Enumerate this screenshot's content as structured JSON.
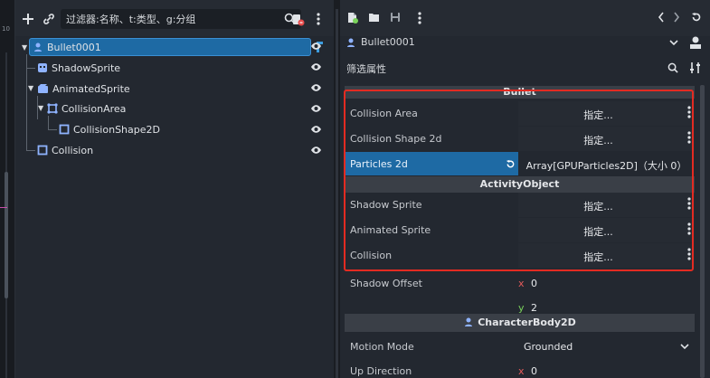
{
  "left_strip": {
    "number": "10"
  },
  "scene_dock": {
    "filter_placeholder": "过滤器:名称、t:类型、g:分组",
    "tree": [
      {
        "label": "Bullet0001",
        "icon": "character-body-icon",
        "selected": true
      },
      {
        "label": "ShadowSprite",
        "icon": "sprite-icon"
      },
      {
        "label": "AnimatedSprite",
        "icon": "animated-sprite-icon"
      },
      {
        "label": "CollisionArea",
        "icon": "area-icon"
      },
      {
        "label": "CollisionShape2D",
        "icon": "collision-shape-icon"
      },
      {
        "label": "Collision",
        "icon": "collision-shape-icon"
      }
    ]
  },
  "inspector": {
    "object_name": "Bullet0001",
    "filter_label": "筛选属性",
    "categories": {
      "bullet": "Bullet",
      "activity": "ActivityObject",
      "character": "CharacterBody2D"
    },
    "props": {
      "collision_area": {
        "name": "Collision Area",
        "value": "指定..."
      },
      "collision_shape": {
        "name": "Collision Shape 2d",
        "value": "指定..."
      },
      "particles": {
        "name": "Particles 2d",
        "value": "Array[GPUParticles2D]（大小 0）"
      },
      "shadow_sprite": {
        "name": "Shadow Sprite",
        "value": "指定..."
      },
      "animated_sprite": {
        "name": "Animated Sprite",
        "value": "指定..."
      },
      "collision": {
        "name": "Collision",
        "value": "指定..."
      },
      "shadow_offset": {
        "name": "Shadow Offset",
        "x_label": "x",
        "x": "0",
        "y_label": "y",
        "y": "2"
      },
      "motion_mode": {
        "name": "Motion Mode",
        "value": "Grounded"
      },
      "up_direction": {
        "name": "Up Direction",
        "x_label": "x",
        "x": "0"
      }
    }
  },
  "colors": {
    "selection": "#1e6aa4",
    "highlight_border": "#e32b22",
    "axis_x": "#e25a5a",
    "axis_y": "#7ad35b"
  }
}
